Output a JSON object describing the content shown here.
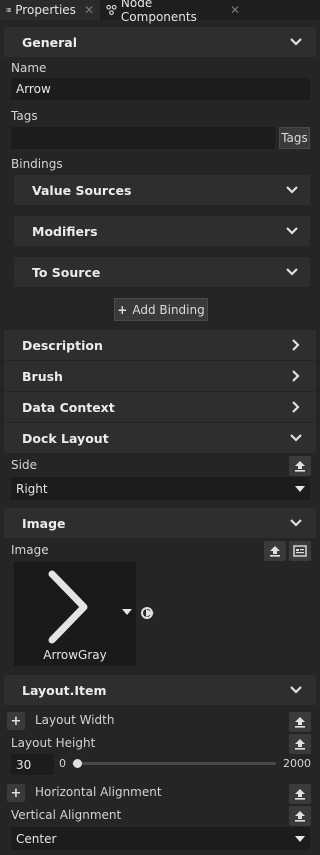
{
  "tabs": [
    {
      "label": "Properties"
    },
    {
      "label": "Node Components"
    }
  ],
  "general": {
    "title": "General",
    "name_label": "Name",
    "name_value": "Arrow",
    "tags_label": "Tags",
    "tags_value": "",
    "tags_button": "Tags",
    "bindings_label": "Bindings",
    "value_sources": "Value Sources",
    "modifiers": "Modifiers",
    "to_source": "To Source",
    "add_binding": "Add Binding"
  },
  "sections": {
    "description": "Description",
    "brush": "Brush",
    "data_context": "Data Context",
    "dock_layout": "Dock Layout",
    "image": "Image",
    "layout_item": "Layout.Item"
  },
  "dock": {
    "side_label": "Side",
    "side_value": "Right"
  },
  "image": {
    "label": "Image",
    "asset_name": "ArrowGray"
  },
  "layout": {
    "layout_width": "Layout Width",
    "layout_height": "Layout Height",
    "height_value": "30",
    "slider_min": "0",
    "slider_max": "2000",
    "slider_fraction": 0.015,
    "horizontal_alignment": "Horizontal Alignment",
    "vertical_alignment": "Vertical Alignment",
    "vertical_value": "Center"
  }
}
